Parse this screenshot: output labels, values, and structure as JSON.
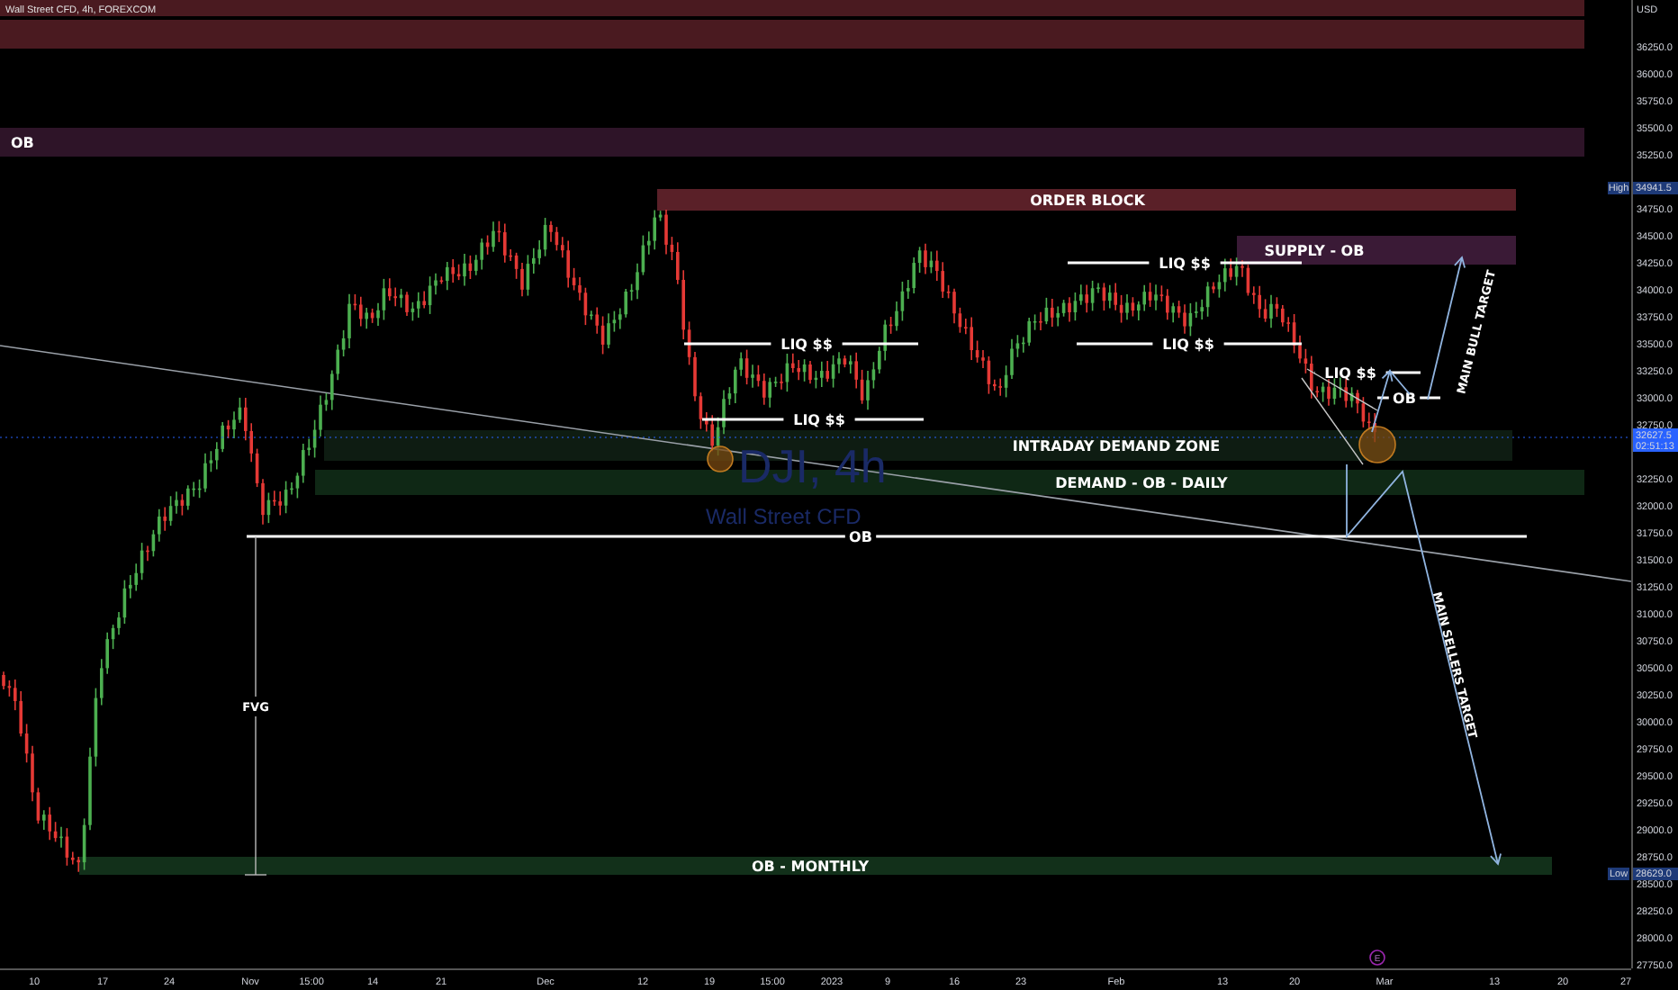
{
  "header": {
    "title": "Wall Street CFD, 4h, FOREXCOM"
  },
  "watermark": {
    "symbol": "DJI, 4h",
    "description": "Wall Street CFD"
  },
  "zones": [
    {
      "color": "#4a1a20"
    },
    {
      "color": "#4a1a20"
    },
    {
      "label": "OB",
      "color": "#2e1428"
    },
    {
      "label": "ORDER BLOCK",
      "color": "#5a2028"
    },
    {
      "label": "SUPPLY - OB",
      "color": "#3a1a36"
    },
    {
      "label": "INTRADAY DEMAND ZONE",
      "color": "#0e1c12"
    },
    {
      "label": "DEMAND - OB - DAILY",
      "color": "#0f2815"
    },
    {
      "label": "OB - MONTHLY",
      "color": "#12301a"
    }
  ],
  "levels": [
    {
      "label": "LIQ $$"
    },
    {
      "label": "LIQ $$"
    },
    {
      "label": "LIQ $$"
    },
    {
      "label": "LIQ $$"
    },
    {
      "label": "LIQ $$"
    },
    {
      "label": "OB"
    },
    {
      "label": "OB"
    }
  ],
  "measure": {
    "label": "FVG"
  },
  "arrows": [
    {
      "label": "MAIN BULL TARGET"
    },
    {
      "label": "MAIN SELLERS TARGET"
    }
  ],
  "event_marker": {
    "text": "E"
  },
  "price_axis": {
    "currency": "USD",
    "labels": [
      "36250.0",
      "36000.0",
      "35750.0",
      "35500.0",
      "35250.0",
      "34750.0",
      "34500.0",
      "34250.0",
      "34000.0",
      "33750.0",
      "33500.0",
      "33250.0",
      "33000.0",
      "32750.0",
      "32250.0",
      "32000.0",
      "31750.0",
      "31500.0",
      "31250.0",
      "31000.0",
      "30750.0",
      "30500.0",
      "30250.0",
      "30000.0",
      "29750.0",
      "29500.0",
      "29250.0",
      "29000.0",
      "28750.0",
      "28500.0",
      "28250.0",
      "28000.0",
      "27750.0"
    ],
    "high": {
      "tag": "High",
      "value": "34941.5"
    },
    "low": {
      "tag": "Low",
      "value": "28629.0"
    },
    "last": {
      "price": "32627.5",
      "countdown": "02:51:13"
    }
  },
  "time_axis": {
    "labels": [
      "10",
      "17",
      "24",
      "Nov",
      "15:00",
      "14",
      "21",
      "Dec",
      "12",
      "19",
      "15:00",
      "2023",
      "9",
      "16",
      "23",
      "Feb",
      "13",
      "20",
      "Mar",
      "13",
      "20",
      "27"
    ]
  }
}
